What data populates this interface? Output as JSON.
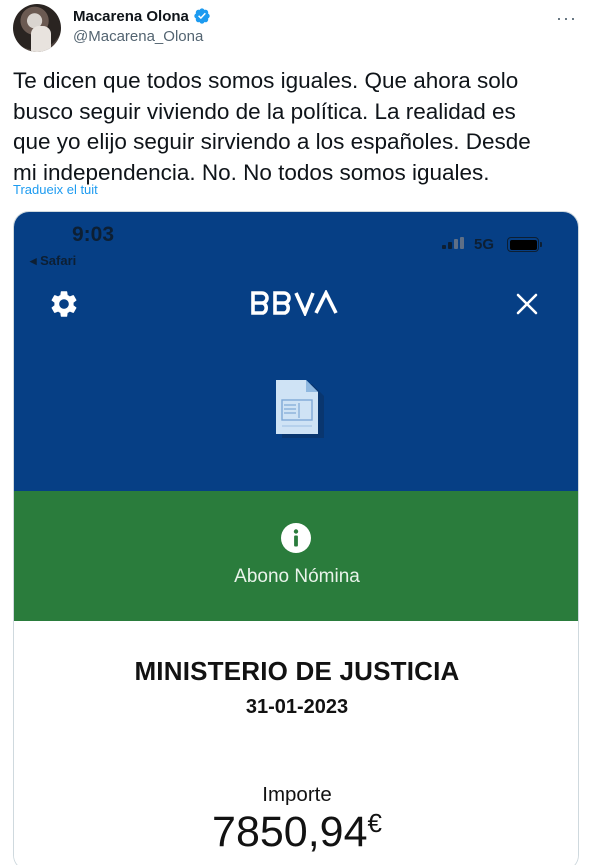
{
  "tweet": {
    "author": {
      "display_name": "Macarena Olona",
      "handle": "@Macarena_Olona",
      "verified": true
    },
    "more_icon": "more-horizontal-icon",
    "text_lines": [
      "Te dicen que todos somos iguales. Que ahora solo",
      "busco seguir viviendo de la política. La realidad es",
      "que yo elijo seguir sirviendo a los españoles. Desde",
      "mi independencia. No. No todos somos iguales."
    ],
    "translate_label": "Tradueix el tuit",
    "link_color": "#1d9bf0"
  },
  "screenshot": {
    "status_bar": {
      "time": "9:03",
      "back_label": "◂ Safari",
      "network": "5G"
    },
    "bank_header": {
      "brand": "BBVA",
      "brand_color": "#063f85",
      "settings_icon": "gear-icon",
      "close_icon": "close-icon",
      "document_icon": "document-icon"
    },
    "movement": {
      "type": "Abono Nómina",
      "banner_color": "#2a7c3c",
      "status_icon": "info-icon"
    },
    "details": {
      "payer": "MINISTERIO DE JUSTICIA",
      "date": "31-01-2023",
      "amount_label": "Importe",
      "amount_value": "7850,94",
      "currency": "€"
    }
  }
}
